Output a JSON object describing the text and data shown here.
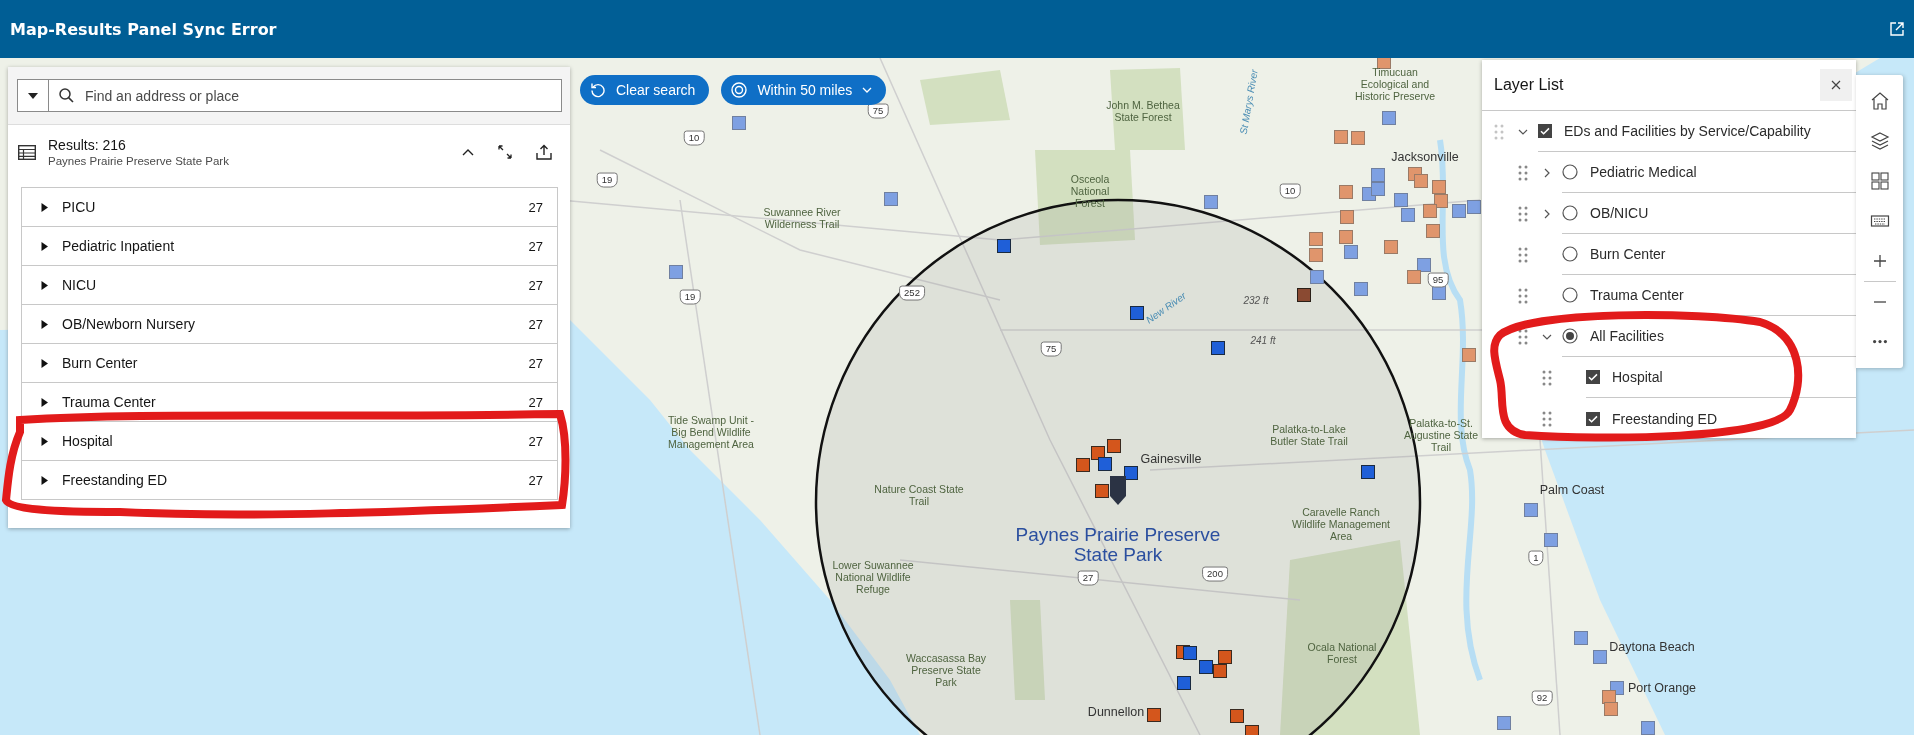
{
  "header": {
    "title": "Map-Results Panel Sync Error"
  },
  "search": {
    "placeholder": "Find an address or place"
  },
  "results": {
    "title": "Results: 216",
    "subtitle": "Paynes Prairie Preserve State Park",
    "groups": [
      {
        "label": "PICU",
        "count": "27",
        "expanded": false
      },
      {
        "label": "Pediatric Inpatient",
        "count": "27",
        "expanded": false
      },
      {
        "label": "NICU",
        "count": "27",
        "expanded": false
      },
      {
        "label": "OB/Newborn Nursery",
        "count": "27",
        "expanded": false
      },
      {
        "label": "Burn Center",
        "count": "27",
        "expanded": false
      },
      {
        "label": "Trauma Center",
        "count": "27",
        "expanded": false
      },
      {
        "label": "Hospital",
        "count": "27",
        "expanded": false
      },
      {
        "label": "Freestanding ED",
        "count": "27",
        "expanded": false
      }
    ]
  },
  "map_buttons": [
    {
      "kind": "clear",
      "label": "Clear search"
    },
    {
      "kind": "distance",
      "label": "Within 50 miles"
    }
  ],
  "layer_list": {
    "title": "Layer List",
    "layers": [
      {
        "label": "EDs and Facilities by Service/Capability",
        "kind": "checkbox",
        "checked": true,
        "expanded": true,
        "children": [
          {
            "label": "Pediatric Medical",
            "kind": "radio",
            "checked": false,
            "expanded": false
          },
          {
            "label": "OB/NICU",
            "kind": "radio",
            "checked": false,
            "expanded": false
          },
          {
            "label": "Burn Center",
            "kind": "radio",
            "checked": false
          },
          {
            "label": "Trauma Center",
            "kind": "radio",
            "checked": false
          },
          {
            "label": "All Facilities",
            "kind": "radio",
            "checked": true,
            "expanded": true,
            "children": [
              {
                "label": "Hospital",
                "kind": "checkbox",
                "checked": true
              },
              {
                "label": "Freestanding ED",
                "kind": "checkbox",
                "checked": true
              }
            ]
          }
        ]
      }
    ]
  },
  "map": {
    "labels": [
      {
        "kind": "area",
        "text": "John M. Bethea State Forest"
      },
      {
        "kind": "area",
        "text": "Osceola National Forest"
      },
      {
        "kind": "area",
        "text": "Suwannee River Wilderness Trail"
      },
      {
        "kind": "area",
        "text": "Tide Swamp Unit - Big Bend Wildlife Management Area"
      },
      {
        "kind": "area",
        "text": "Nature Coast State Trail"
      },
      {
        "kind": "area",
        "text": "Lower Suwannee National Wildlife Refuge"
      },
      {
        "kind": "area",
        "text": "Waccasassa Bay Preserve State Park"
      },
      {
        "kind": "area",
        "text": "Palatka-to-Lake Butler State Trail"
      },
      {
        "kind": "area",
        "text": "Palatka-to-St. Augustine State Trail"
      },
      {
        "kind": "area",
        "text": "Caravelle Ranch Wildlife Management Area"
      },
      {
        "kind": "area",
        "text": "Ocala National Forest"
      },
      {
        "kind": "area",
        "text": "Timucuan Ecological and Historic Preserve"
      },
      {
        "kind": "city",
        "text": "Gainesville"
      },
      {
        "kind": "city",
        "text": "Jacksonville"
      },
      {
        "kind": "city",
        "text": "Dunnellon"
      },
      {
        "kind": "city",
        "text": "Palm Coast"
      },
      {
        "kind": "city",
        "text": "Daytona Beach"
      },
      {
        "kind": "city",
        "text": "Port Orange"
      },
      {
        "kind": "search-result",
        "text": "Paynes Prairie Preserve State Park"
      },
      {
        "kind": "river",
        "text": "St Marys River"
      },
      {
        "kind": "river",
        "text": "New River"
      },
      {
        "kind": "elevation",
        "text": "232 ft"
      },
      {
        "kind": "elevation",
        "text": "241 ft"
      },
      {
        "kind": "shield",
        "text": "10"
      },
      {
        "kind": "shield",
        "text": "75"
      },
      {
        "kind": "shield",
        "text": "19"
      },
      {
        "kind": "shield",
        "text": "19"
      },
      {
        "kind": "shield",
        "text": "252"
      },
      {
        "kind": "shield",
        "text": "75"
      },
      {
        "kind": "shield",
        "text": "10"
      },
      {
        "kind": "shield",
        "text": "95"
      },
      {
        "kind": "shield",
        "text": "200"
      },
      {
        "kind": "shield",
        "text": "27"
      },
      {
        "kind": "shield",
        "text": "1"
      },
      {
        "kind": "shield",
        "text": "92"
      }
    ]
  }
}
